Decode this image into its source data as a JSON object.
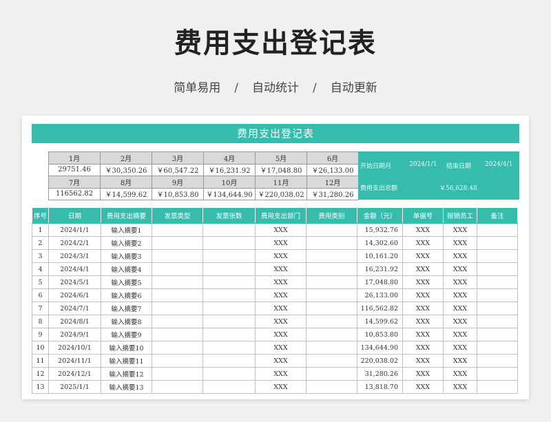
{
  "header": {
    "title": "费用支出登记表",
    "subtitle_items": [
      "简单易用",
      "自动统计",
      "自动更新"
    ],
    "separator": "/"
  },
  "sheet": {
    "banner": "费用支出登记表",
    "months_row1": [
      {
        "label": "1月",
        "value": "29751.46"
      },
      {
        "label": "2月",
        "value": "￥30,350.26"
      },
      {
        "label": "3月",
        "value": "￥60,547.22"
      },
      {
        "label": "4月",
        "value": "￥16,231.92"
      },
      {
        "label": "5月",
        "value": "￥17,048.80"
      },
      {
        "label": "6月",
        "value": "￥26,133.00"
      }
    ],
    "months_row2": [
      {
        "label": "7月",
        "value": "116562.82"
      },
      {
        "label": "8月",
        "value": "￥14,599.62"
      },
      {
        "label": "9月",
        "value": "￥10,853.80"
      },
      {
        "label": "10月",
        "value": "￥134,644.90"
      },
      {
        "label": "11月",
        "value": "￥220,038.02"
      },
      {
        "label": "12月",
        "value": "￥31,280.26"
      }
    ],
    "summary": {
      "start_label": "开始日期月",
      "start_value": "2024/1/1",
      "end_label": "结束日期",
      "end_value": "2024/4/1",
      "total_label": "费用支出总额",
      "total_value": "￥56,628.48"
    },
    "columns": [
      "序号",
      "日期",
      "费用支出摘要",
      "发票类型",
      "发票张数",
      "费用支出部门",
      "费用类别",
      "金额（元）",
      "单据号",
      "报销员工",
      "备注"
    ],
    "rows": [
      {
        "no": "1",
        "date": "2024/1/1",
        "summary": "输入摘要1",
        "dept": "XXX",
        "amount": "15,932.76",
        "doc": "XXX",
        "staff": "XXX"
      },
      {
        "no": "2",
        "date": "2024/2/1",
        "summary": "输入摘要2",
        "dept": "XXX",
        "amount": "14,302.60",
        "doc": "XXX",
        "staff": "XXX"
      },
      {
        "no": "3",
        "date": "2024/3/1",
        "summary": "输入摘要3",
        "dept": "XXX",
        "amount": "10,161.20",
        "doc": "XXX",
        "staff": "XXX"
      },
      {
        "no": "4",
        "date": "2024/4/1",
        "summary": "输入摘要4",
        "dept": "XXX",
        "amount": "16,231.92",
        "doc": "XXX",
        "staff": "XXX"
      },
      {
        "no": "5",
        "date": "2024/5/1",
        "summary": "输入摘要5",
        "dept": "XXX",
        "amount": "17,048.80",
        "doc": "XXX",
        "staff": "XXX"
      },
      {
        "no": "6",
        "date": "2024/6/1",
        "summary": "输入摘要6",
        "dept": "XXX",
        "amount": "26,133.00",
        "doc": "XXX",
        "staff": "XXX"
      },
      {
        "no": "7",
        "date": "2024/7/1",
        "summary": "输入摘要7",
        "dept": "XXX",
        "amount": "116,562.82",
        "doc": "XXX",
        "staff": "XXX"
      },
      {
        "no": "8",
        "date": "2024/8/1",
        "summary": "输入摘要8",
        "dept": "XXX",
        "amount": "14,599.62",
        "doc": "XXX",
        "staff": "XXX"
      },
      {
        "no": "9",
        "date": "2024/9/1",
        "summary": "输入摘要9",
        "dept": "XXX",
        "amount": "10,853.80",
        "doc": "XXX",
        "staff": "XXX"
      },
      {
        "no": "10",
        "date": "2024/10/1",
        "summary": "输入摘要10",
        "dept": "XXX",
        "amount": "134,644.90",
        "doc": "XXX",
        "staff": "XXX"
      },
      {
        "no": "11",
        "date": "2024/11/1",
        "summary": "输入摘要11",
        "dept": "XXX",
        "amount": "220,038.02",
        "doc": "XXX",
        "staff": "XXX"
      },
      {
        "no": "12",
        "date": "2024/12/1",
        "summary": "输入摘要12",
        "dept": "XXX",
        "amount": "31,280.26",
        "doc": "XXX",
        "staff": "XXX"
      },
      {
        "no": "13",
        "date": "2025/1/1",
        "summary": "输入摘要13",
        "dept": "XXX",
        "amount": "13,818.70",
        "doc": "XXX",
        "staff": "XXX"
      }
    ]
  }
}
